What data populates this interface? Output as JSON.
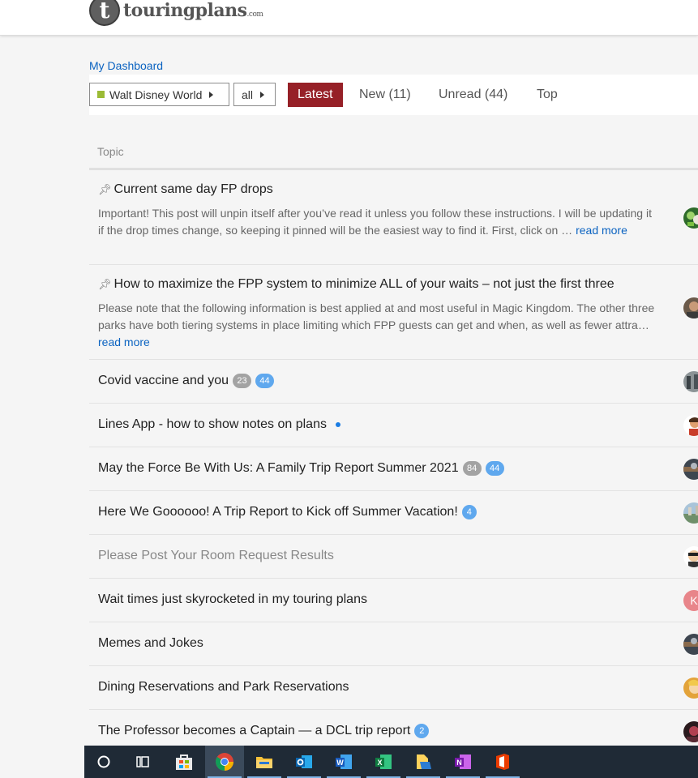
{
  "header": {
    "logo_letter": "t",
    "logo_name": "touringplans",
    "logo_tld": ".com"
  },
  "breadcrumb": {
    "label": "My Dashboard"
  },
  "filters": {
    "category": "Walt Disney World",
    "tags": "all"
  },
  "nav": {
    "latest": "Latest",
    "new": "New (11)",
    "unread": "Unread (44)",
    "top": "Top"
  },
  "table": {
    "header_topic": "Topic"
  },
  "topics": [
    {
      "title": "Current same day FP drops",
      "excerpt": "Important! This post will unpin itself after you’ve read it unless you follow these instructions. I will be updating it if the drop times change, so keeping it pinned will be the easiest way to find it. First, click on …",
      "read_more": "read more"
    },
    {
      "title": "How to maximize the FPP system to minimize ALL of your waits – not just the first three",
      "excerpt": "Please note that the following information is best applied at and most useful in Magic Kingdom. The other three parks have both tiering systems in place limiting which FPP guests can get and when, as well as fewer attra…",
      "read_more": "read more"
    },
    {
      "title": "Covid vaccine and you",
      "badge_unread": "23",
      "badge_new": "44"
    },
    {
      "title": "Lines App - how to show notes on plans"
    },
    {
      "title": "May the Force Be With Us: A Family Trip Report Summer 2021",
      "badge_unread": "84",
      "badge_new": "44"
    },
    {
      "title": "Here We Goooooo! A Trip Report to Kick off Summer Vacation!",
      "badge_new": "4"
    },
    {
      "title": "Please Post Your Room Request Results"
    },
    {
      "title": "Wait times just skyrocketed in my touring plans",
      "avatar_letter": "K"
    },
    {
      "title": "Memes and Jokes"
    },
    {
      "title": "Dining Reservations and Park Reservations"
    },
    {
      "title": "The Professor becomes a Captain — a DCL trip report",
      "badge_new": "2"
    }
  ],
  "colors": {
    "accent": "#962027",
    "link": "#0b63c1",
    "category": "#9bbb35",
    "badge_new": "#5fa8ee",
    "badge_unread": "#a3a3a3",
    "taskbar": "#1f2a36"
  },
  "taskbar": [
    "cortana-icon",
    "task-view-icon",
    "store-icon",
    "chrome-icon",
    "file-explorer-icon",
    "outlook-icon",
    "word-icon",
    "excel-icon",
    "files-icon",
    "onenote-icon",
    "office-icon"
  ]
}
